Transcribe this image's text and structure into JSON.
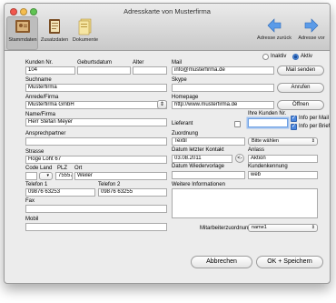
{
  "window": {
    "title": "Adresskarte von Musterfirma"
  },
  "toolbar": {
    "stammdaten": "Stammdaten",
    "zusatzdaten": "Zusatzdaten",
    "dokumente": "Dokumente",
    "back": "Adresse zurück",
    "forward": "Adresse vor"
  },
  "status": {
    "inaktiv": "Inaktiv",
    "aktiv": "Aktiv",
    "selected": "Aktiv"
  },
  "form": {
    "kundennr": {
      "label": "Kunden Nr.",
      "value": "104"
    },
    "geburtsdatum": {
      "label": "Geburtsdatum",
      "value": ""
    },
    "alter": {
      "label": "Alter",
      "value": ""
    },
    "mail": {
      "label": "Mail",
      "value": "info@musterfirma.de",
      "button": "Mail senden"
    },
    "suchname": {
      "label": "Suchname",
      "value": "Musterfirma"
    },
    "skype": {
      "label": "Skype",
      "value": "",
      "button": "Anrufen"
    },
    "anrede": {
      "label": "Anrede/Firma",
      "value": "Musterfirma GmbH"
    },
    "homepage": {
      "label": "Homepage",
      "value": "http://www.musterfirma.de",
      "button": "Öffnen"
    },
    "name": {
      "label": "Name/Firma",
      "value": "Herr Stefan Meyer"
    },
    "lieferant": {
      "label": "Lieferant",
      "checked": false
    },
    "ihre_kundennr": {
      "label": "Ihre Kunden Nr.",
      "value": ""
    },
    "info_mail": {
      "label": "Info per Mail",
      "checked": true
    },
    "info_brief": {
      "label": "Info per Brief",
      "checked": true
    },
    "ansprechpartner": {
      "label": "Ansprechpartner",
      "value": ""
    },
    "zuordnung": {
      "label": "Zuordnung",
      "value": "Textil",
      "select": "Bitte wählen"
    },
    "strasse": {
      "label": "Strasse",
      "value": "Hoge Loht 67"
    },
    "datum_kontakt": {
      "label": "Datum letzter Kontakt",
      "value": "03.08.2011",
      "arrow": "<-"
    },
    "anlass": {
      "label": "Anlass",
      "value": "Aktion"
    },
    "code": {
      "label": "Code",
      "value": ""
    },
    "land": {
      "label": "Land",
      "value": ""
    },
    "plz": {
      "label": "PLZ",
      "value": "75557"
    },
    "ort": {
      "label": "Ort",
      "value": "Weiler"
    },
    "datum_wiedervorlage": {
      "label": "Datum Wiedervorlage",
      "value": ""
    },
    "kundenkennung": {
      "label": "Kundenkennung",
      "value": "web"
    },
    "telefon1": {
      "label": "Telefon 1",
      "value": "09876 63253"
    },
    "telefon2": {
      "label": "Telefon 2",
      "value": "09876 63255"
    },
    "weitere": {
      "label": "Weitere Informationen",
      "value": ""
    },
    "fax": {
      "label": "Fax",
      "value": ""
    },
    "mobil": {
      "label": "Mobil",
      "value": ""
    },
    "mitarbeiter": {
      "label": "Mitarbeiterzuordnung:",
      "value": "name1"
    }
  },
  "buttons": {
    "abbrechen": "Abbrechen",
    "speichern": "OK + Speichern"
  },
  "colors": {
    "accent": "#4b86dd",
    "window_bg": "#ececec"
  }
}
